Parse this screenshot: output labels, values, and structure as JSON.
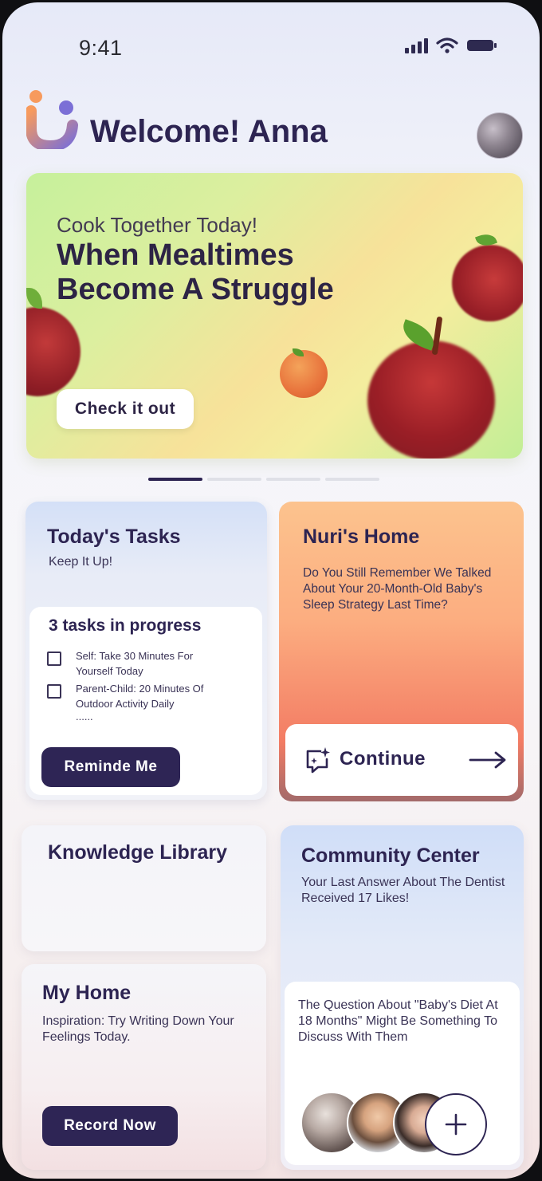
{
  "status": {
    "time": "9:41"
  },
  "header": {
    "welcome": "Welcome! Anna"
  },
  "banner": {
    "subtitle": "Cook Together Today!",
    "title": "When Mealtimes Become A Struggle",
    "button": "Check it out",
    "page_count": 4,
    "active_page": 1
  },
  "tasks": {
    "title": "Today's Tasks",
    "subtitle": "Keep It Up!",
    "progress": "3 tasks in progress",
    "items": [
      {
        "label": "Self: Take 30 Minutes For Yourself Today",
        "checked": false
      },
      {
        "label": "Parent-Child: 20 Minutes Of Outdoor Activity Daily",
        "checked": false
      }
    ],
    "more": "......",
    "button": "Reminde Me"
  },
  "nuri": {
    "title": "Nuri's Home",
    "text": "Do You Still Remember We Talked About Your 20-Month-Old Baby's Sleep Strategy Last Time?",
    "button": "Continue"
  },
  "knowledge": {
    "title": "Knowledge Library"
  },
  "community": {
    "title": "Community Center",
    "text": "Your Last Answer About The Dentist Received 17 Likes!",
    "question": "The Question About \"Baby's Diet At 18 Months\" Might Be Something To Discuss With Them"
  },
  "myhome": {
    "title": "My Home",
    "text": "Inspiration: Try Writing Down Your Feelings Today.",
    "button": "Record Now"
  },
  "icons": {
    "signal": "cellular-signal-icon",
    "wifi": "wifi-icon",
    "battery": "battery-icon",
    "logo": "app-logo",
    "chat": "chat-sparkle-icon",
    "arrow": "arrow-right-icon",
    "plus": "plus-icon"
  },
  "colors": {
    "primary": "#2e2555",
    "banner_start": "#c6f09c",
    "banner_mid": "#f7e29a",
    "nuri_top": "#fcc38e",
    "nuri_bottom": "#f37c64",
    "community_top": "#d0def8"
  }
}
